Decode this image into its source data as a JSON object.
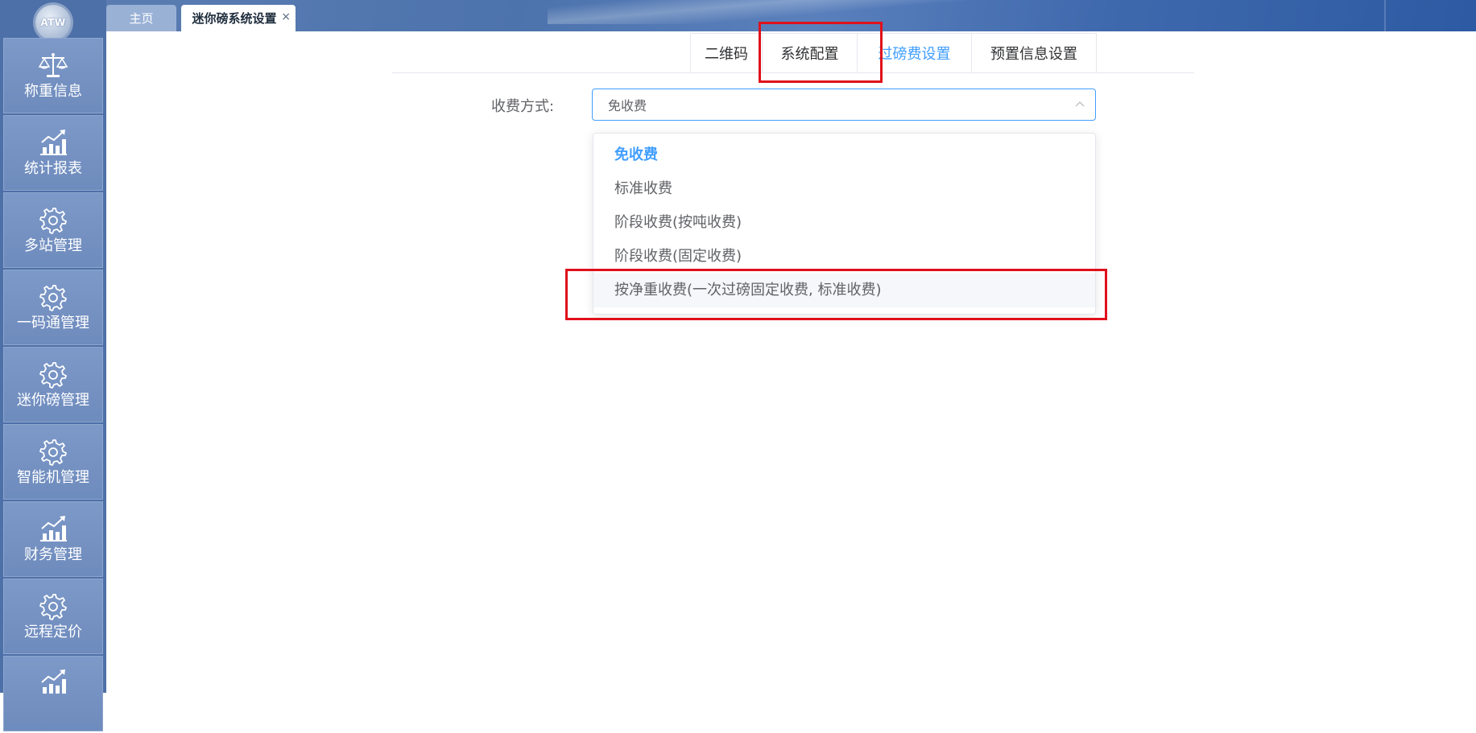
{
  "logo": {
    "text": "ATW"
  },
  "sidebar": {
    "items": [
      {
        "label": "称重信息",
        "icon": "scale-icon"
      },
      {
        "label": "统计报表",
        "icon": "chart-icon"
      },
      {
        "label": "多站管理",
        "icon": "gear-icon"
      },
      {
        "label": "一码通管理",
        "icon": "gear-icon"
      },
      {
        "label": "迷你磅管理",
        "icon": "gear-icon"
      },
      {
        "label": "智能机管理",
        "icon": "gear-icon"
      },
      {
        "label": "财务管理",
        "icon": "chart-icon"
      },
      {
        "label": "远程定价",
        "icon": "gear-icon"
      },
      {
        "label": "",
        "icon": "chart-icon"
      }
    ]
  },
  "page_tabs": {
    "home": "主页",
    "active": "迷你磅系统设置",
    "close": "×"
  },
  "settings_tabs": [
    "二维码",
    "系统配置",
    "过磅费设置",
    "预置信息设置"
  ],
  "active_settings_tab": "过磅费设置",
  "form": {
    "fee_label": "收费方式:",
    "fee_value": "免收费"
  },
  "dropdown": {
    "options": [
      "免收费",
      "标准收费",
      "阶段收费(按吨收费)",
      "阶段收费(固定收费)",
      "按净重收费(一次过磅固定收费, 标准收费)"
    ],
    "selected": "免收费",
    "hovered": "按净重收费(一次过磅固定收费, 标准收费)"
  },
  "colors": {
    "accent": "#409eff",
    "highlight_box": "#e0101a",
    "sidebar": "#4e70a8"
  }
}
